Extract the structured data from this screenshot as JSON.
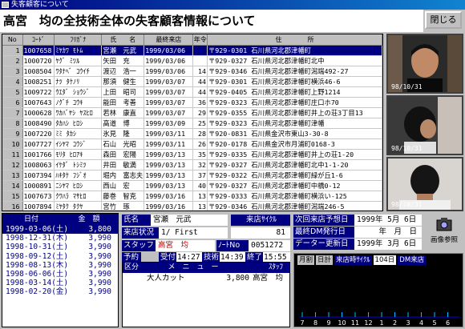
{
  "window": {
    "title": "失客顧客について"
  },
  "header": {
    "title": "高宮　均の全技術全体の失客顧客情報について"
  },
  "close_label": "閉じる",
  "columns": [
    "No",
    "ｺｰﾄﾞ",
    "ﾌﾘｶﾞﾅ",
    "氏　　名",
    "最終来店",
    "年令",
    "住　　　　所"
  ],
  "rows": [
    [
      "1",
      "1007658",
      "ﾐﾔｶﾜ ﾓﾄﾑ",
      "宮瀬　元武",
      "1999/03/06",
      "",
      "〒929-0301 石川県河北郡津幡町"
    ],
    [
      "2",
      "1000720",
      "ﾔｸﾞ ﾐﾂﾙ",
      "矢田　充",
      "1999/03/06",
      "",
      "〒929-0327 石川県河北郡津幡町北中"
    ],
    [
      "3",
      "1008504",
      "ﾜﾀﾅﾍﾞ ｺｳｲﾁ",
      "渡辺　浩一",
      "1999/03/06",
      "14",
      "〒929-0346 石川県河北郡津幡町潟端492-27"
    ],
    [
      "4",
      "1008251",
      "ﾅﾂ ﾀｹﾉﾘ",
      "那須　健生",
      "1999/03/07",
      "44",
      "〒929-0301 石川県河北郡津幡町横浜46-6"
    ],
    [
      "5",
      "1009722",
      "ｳｴﾀﾞ ｼｮｳｼﾞ",
      "上田　昭司",
      "1999/03/07",
      "44",
      "〒929-0405 石川県河北郡津幡町上野1214"
    ],
    [
      "6",
      "1007643",
      "ﾉｸﾞﾁ ｺｳｷ",
      "能田　考善",
      "1999/03/07",
      "36",
      "〒929-0323 石川県河北郡津幡町庄口ホ70"
    ],
    [
      "7",
      "1000628",
      "ﾜｶﾊﾞﾔｼ ﾔｽﾋﾛ",
      "若林　康直",
      "1999/03/07",
      "29",
      "〒929-0355 石川県河北郡津幡町井上の荘3丁目13"
    ],
    [
      "8",
      "1008490",
      "ﾀｶﾊｼ ﾋﾛｼ",
      "高道　博",
      "1999/03/09",
      "25",
      "〒929-0323 石川県河北郡津幡町津幡"
    ],
    [
      "9",
      "1007220",
      "ﾐﾐ ﾀｶｼ",
      "氷見　隆",
      "1999/03/11",
      "28",
      "〒920-0831 石川県金沢市東山3-30-8"
    ],
    [
      "10",
      "1007727",
      "ｲｼﾔﾏ ｺｳｼﾞ",
      "石山　光昭",
      "1999/03/11",
      "26",
      "〒920-0178 石川県金沢市月浦町0168-3"
    ],
    [
      "11",
      "1001766",
      "ﾓﾘﾀ ﾋﾛｱｷ",
      "森田　宏陽",
      "1999/03/13",
      "35",
      "〒929-0335 石川県河北郡津幡町井上の荘1-20"
    ],
    [
      "12",
      "1008063",
      "ｲｹﾀﾞ ﾄｼﾐﾂ",
      "井田　敏満",
      "1999/03/13",
      "32",
      "〒929-0327 石川県河北郡津幡町北中1-1-20"
    ],
    [
      "13",
      "1007394",
      "ﾊｷﾀｹ ﾌｼﾞｵ",
      "堀内　富志夫",
      "1999/03/13",
      "37",
      "〒929-0322 石川県河北郡津幡町緑が丘1-6"
    ],
    [
      "14",
      "1000891",
      "ﾆｼﾔﾏ ﾋﾛｼ",
      "西山　宏",
      "1999/03/13",
      "40",
      "〒929-0327 石川県河北郡津幡町中橋0-12"
    ],
    [
      "15",
      "1007673",
      "ｸﾜﾊﾗ ﾏｻﾋﾛ",
      "藤巻　智克",
      "1999/03/16",
      "13",
      "〒929-0333 石川県河北郡津幡町横浜い-125"
    ],
    [
      "16",
      "1007894",
      "ﾐﾔﾀｸ ﾀｸﾔ",
      "宮竹　琢",
      "1999/03/16",
      "13",
      "〒929-0346 石川県河北郡津幡町潟端246-5"
    ],
    [
      "17",
      "1009550",
      "ﾐﾔﾀ ｶｵﾘ",
      "宮田　かおり",
      "1999/03/16",
      "13",
      "〒929-0342 石川県河北郡津幡町太田3-170-"
    ]
  ],
  "photos": [
    {
      "date": "98/10/31"
    },
    {
      "date": "98/10/31"
    },
    {
      "date": "98/10/31"
    }
  ],
  "history": {
    "head_date": "日付",
    "head_amount": "金　額",
    "rows": [
      [
        "1998-12-31(木)",
        "3,990"
      ],
      [
        "1998-10-31(土)",
        "3,990"
      ],
      [
        "1998-09-12(土)",
        "3,990"
      ],
      [
        "1998-08-13(木)",
        "3,990"
      ],
      [
        "1998-06-06(土)",
        "3,990"
      ],
      [
        "1998-03-14(土)",
        "3,990"
      ],
      [
        "1998-02-20(金)",
        "3,990"
      ]
    ]
  },
  "detail": {
    "name_label": "氏名",
    "name_value": "宮瀬　元武",
    "store_label": "来店状況",
    "store_value": "1/ First",
    "staff_label": "スタッフ",
    "staff_value": "高宮　均",
    "note_label": "ﾉｰﾄNo",
    "note_value": "0051272",
    "reserve_label": "予約",
    "accept_label": "受付",
    "accept_value": "14:27",
    "stylist_label": "技術",
    "stylist_value": "14:39",
    "end_label": "終了",
    "end_value": "15:55",
    "cycle_label": "来店ｻｲｸﾙ",
    "cycle_value": "81",
    "next_label": "次回来店予想日",
    "next_value": "1999年 5月 6日",
    "dm_label": "最終DM発行日",
    "dm_value": "年　月　日",
    "update_label": "データー更新日",
    "update_value": "1999年 3月 6日",
    "image_button": "画像参照"
  },
  "menu": {
    "head_category": "区分",
    "head_menu": "メ　ニ　ュ　ー",
    "head_staff": "ｽﾀｯﾌ",
    "items": [
      {
        "name": "大人カット",
        "amount": "3,800",
        "staff": "高宮　均"
      }
    ]
  },
  "cycle_chart": {
    "month_label": "月割",
    "total_label": "日計",
    "cycle_label": "来店時ｻｲｸﾙ",
    "cycle_value": "104日",
    "dm_label": "DM来店",
    "ticks": [
      "7",
      "8",
      "9",
      "10",
      "11",
      "12",
      "1",
      "2",
      "3",
      "4",
      "5",
      "6"
    ],
    "colors": {
      "axis": "#0000ff",
      "bar": "#00bfff"
    }
  }
}
